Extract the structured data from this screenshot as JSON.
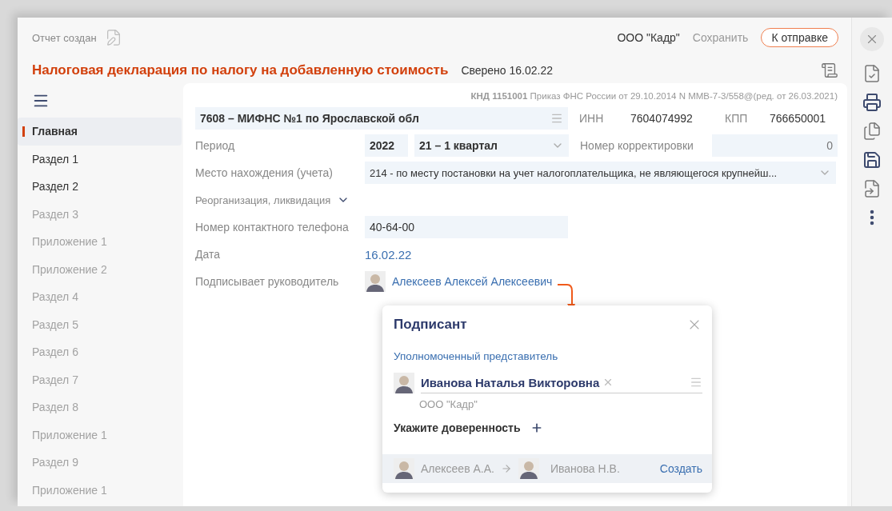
{
  "header": {
    "status": "Отчет создан",
    "organization": "ООО \"Кадр\"",
    "save": "Сохранить",
    "send": "К отправке"
  },
  "title": "Налоговая декларация по налогу на добавленную стоимость",
  "verified": "Сверено 16.02.22",
  "sidebar": {
    "items": [
      {
        "label": "Главная",
        "selected": true,
        "disabled": false
      },
      {
        "label": "Раздел 1",
        "selected": false,
        "disabled": false
      },
      {
        "label": "Раздел 2",
        "selected": false,
        "disabled": false
      },
      {
        "label": "Раздел 3",
        "selected": false,
        "disabled": true
      },
      {
        "label": "Приложение 1",
        "selected": false,
        "disabled": true
      },
      {
        "label": "Приложение 2",
        "selected": false,
        "disabled": true
      },
      {
        "label": "Раздел 4",
        "selected": false,
        "disabled": true
      },
      {
        "label": "Раздел 5",
        "selected": false,
        "disabled": true
      },
      {
        "label": "Раздел 6",
        "selected": false,
        "disabled": true
      },
      {
        "label": "Раздел 7",
        "selected": false,
        "disabled": true
      },
      {
        "label": "Раздел 8",
        "selected": false,
        "disabled": true
      },
      {
        "label": "Приложение 1",
        "selected": false,
        "disabled": true
      },
      {
        "label": "Раздел 9",
        "selected": false,
        "disabled": true
      },
      {
        "label": "Приложение 1",
        "selected": false,
        "disabled": true
      }
    ]
  },
  "form": {
    "knd": "КНД 1151001",
    "order": "Приказ ФНС России от 29.10.2014 N ММВ-7-3/558@(ред. от 26.03.2021)",
    "inspection": "7608 – МИФНС №1 по Ярославской обл",
    "inn_label": "ИНН",
    "inn": "7604074992",
    "kpp_label": "КПП",
    "kpp": "766650001",
    "period_label": "Период",
    "year": "2022",
    "quarter": "21 – 1 квартал",
    "correction_label": "Номер корректировки",
    "correction": "0",
    "location_label": "Место нахождения (учета)",
    "location": "214 - по месту постановки на учет налогоплательщика, не являющегося крупнейш...",
    "reorg_label": "Реорганизация, ликвидация",
    "reorg_expanded": false,
    "phone_label": "Номер контактного телефона",
    "phone": "40-64-00",
    "date_label": "Дата",
    "date": "16.02.22",
    "signer_label": "Подписывает руководитель",
    "signer": "Алексеев Алексей Алексеевич"
  },
  "popup": {
    "title": "Подписант",
    "role": "Уполномоченный представитель",
    "person": "Иванова Наталья Викторовна",
    "company": "ООО \"Кадр\"",
    "proxy": "Укажите доверенность",
    "chain_from": "Алексеев А.А.",
    "chain_to": "Иванова Н.В.",
    "create": "Создать"
  }
}
